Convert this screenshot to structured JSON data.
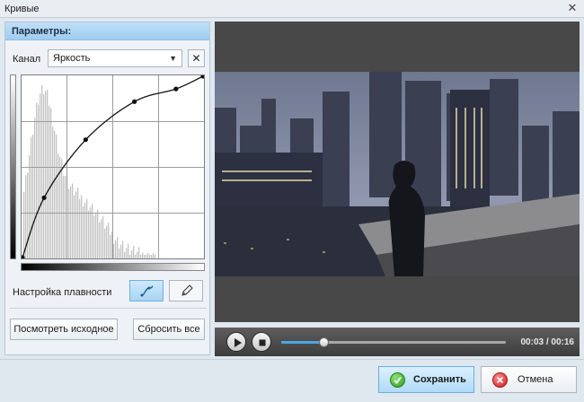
{
  "window": {
    "title": "Кривые",
    "close_icon": "close-icon"
  },
  "params": {
    "header": "Параметры:",
    "channel_label": "Канал",
    "channel_value": "Яркость",
    "clear_icon": "x-icon",
    "curve_points": [
      {
        "in": 0,
        "out": 0
      },
      {
        "in": 0.12,
        "out": 0.33
      },
      {
        "in": 0.35,
        "out": 0.65
      },
      {
        "in": 0.62,
        "out": 0.86
      },
      {
        "in": 0.85,
        "out": 0.93
      },
      {
        "in": 1,
        "out": 1
      }
    ],
    "smooth_label": "Настройка плавности",
    "smooth_icon": "curve-tool-icon",
    "pencil_icon": "pencil-icon",
    "view_original_label": "Посмотреть исходное",
    "reset_all_label": "Сбросить все"
  },
  "player": {
    "play_icon": "play-icon",
    "stop_icon": "stop-icon",
    "progress": 0.1875,
    "time": "00:03 / 00:16"
  },
  "footer": {
    "save_label": "Сохранить",
    "cancel_label": "Отмена"
  }
}
